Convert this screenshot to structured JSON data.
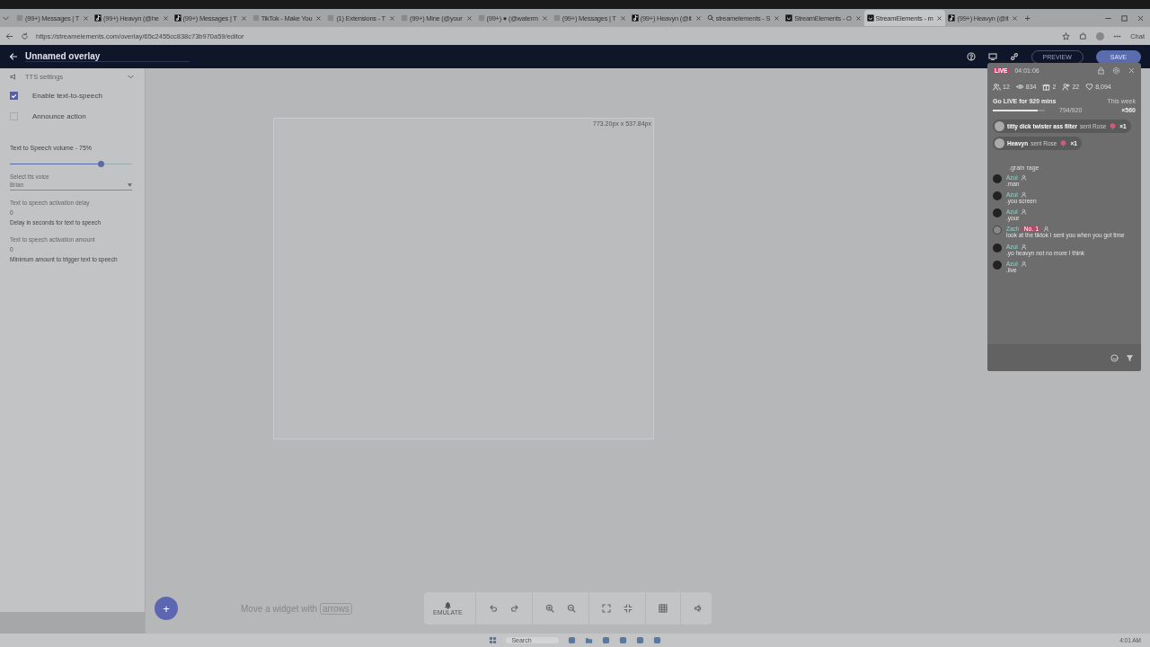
{
  "browser": {
    "tabs": [
      {
        "title": "(99+) Messages | T",
        "kind": "page",
        "selected": false
      },
      {
        "title": "(99+) Heavyn (@he",
        "kind": "tiktok",
        "selected": false
      },
      {
        "title": "(99+) Messages | T",
        "kind": "tiktok",
        "selected": false
      },
      {
        "title": "TikTok - Make You",
        "kind": "page",
        "selected": false
      },
      {
        "title": "(1) Extensions - T",
        "kind": "page",
        "selected": false
      },
      {
        "title": "(99+) Mine (@your",
        "kind": "page",
        "selected": false
      },
      {
        "title": "(99+) ● (@waterm",
        "kind": "page",
        "selected": false
      },
      {
        "title": "(99+) Messages | T",
        "kind": "page",
        "selected": false
      },
      {
        "title": "(99+) Heavyn (@it",
        "kind": "tiktok",
        "selected": false
      },
      {
        "title": "streamelements - S",
        "kind": "search",
        "selected": false
      },
      {
        "title": "StreamElements - O",
        "kind": "se",
        "selected": false
      },
      {
        "title": "StreamElements - m",
        "kind": "se",
        "selected": true
      },
      {
        "title": "(99+) Heavyn (@it",
        "kind": "tiktok",
        "selected": false
      }
    ],
    "new_tab": "+",
    "url": "https://streamelements.com/overlay/65c2455cc838c73b970a59/editor",
    "chat": "Chat"
  },
  "header": {
    "title": "Unnamed overlay",
    "preview": "PREVIEW",
    "save": "SAVE"
  },
  "sidebar": {
    "section": "TTS settings",
    "options": [
      {
        "label": "Enable text-to-speech",
        "checked": true
      },
      {
        "label": "Announce action",
        "checked": false
      }
    ],
    "volume_label": "Text to Speech volume - 75%",
    "volume": {
      "level": 0.75
    },
    "voice_label": "Select tts voice",
    "voice": "Brian",
    "fields": [
      {
        "label": "Text to speech activation delay",
        "value": "0",
        "hint": "Delay in seconds for text to speech"
      },
      {
        "label": "Text to speech activation amount",
        "value": "0",
        "hint": "Minimum amount to trigger text to speech"
      }
    ]
  },
  "canvas": {
    "size": "773.20px x 537.84px",
    "add": "+",
    "hint": "Move a widget with",
    "hint_key": "arrows"
  },
  "toolbar": {
    "emulate": "EMULATE"
  },
  "live": {
    "badge": "LIVE",
    "timer": "04:01:06",
    "stats": [
      {
        "kind": "viewers",
        "value": "12"
      },
      {
        "kind": "views",
        "value": "834"
      },
      {
        "kind": "gifts",
        "value": "2"
      },
      {
        "kind": "followers",
        "value": "22"
      },
      {
        "kind": "likes",
        "value": "8,094"
      }
    ],
    "goal": "Go LIVE for 920 mins",
    "period": "This week",
    "progress": {
      "level": 0.863
    },
    "progress_text": "794/920",
    "reward": "×560",
    "gifts": [
      {
        "name": "titty dick twister ass filter",
        "action": "sent Rose",
        "count": "×1"
      },
      {
        "name": "Heavyn",
        "action": "sent Rose",
        "count": "×1"
      }
    ],
    "previous": ".grain rage",
    "chat": [
      {
        "name": "Azul",
        "text": ".man",
        "kind": "dark"
      },
      {
        "name": "Azul",
        "text": ".you screen",
        "kind": "dark"
      },
      {
        "name": "Azul",
        "text": ".your",
        "kind": "dark"
      },
      {
        "name": "Zach",
        "text": "look at the tiktok I sent you when you got time",
        "kind": "photo",
        "badge": "No. 1"
      },
      {
        "name": "Azul",
        "text": ".yo heavyn not no more I think",
        "kind": "dark"
      },
      {
        "name": "Azul",
        "text": ".live",
        "kind": "dark"
      }
    ]
  },
  "taskbar": {
    "search": "Search",
    "time": "4:01 AM"
  }
}
